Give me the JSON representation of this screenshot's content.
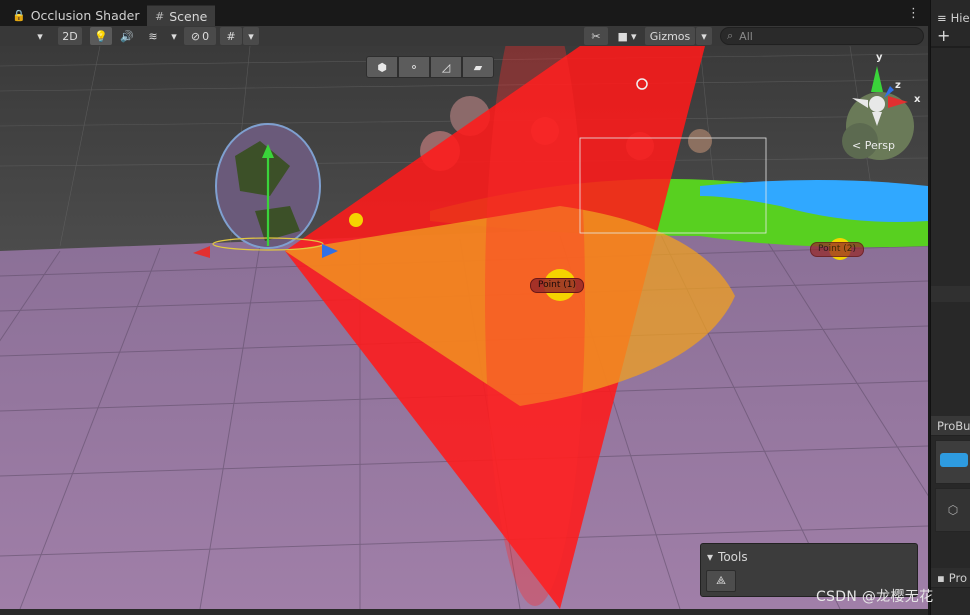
{
  "tabs": [
    {
      "label": "Occlusion Shader",
      "icon": "shader-icon",
      "active": false
    },
    {
      "label": "Scene",
      "icon": "grid-icon",
      "active": true
    }
  ],
  "toolbar": {
    "mode_2d": "2D",
    "hidden_count": "0",
    "gizmos_label": "Gizmos",
    "search_placeholder": "All"
  },
  "scene": {
    "projection_label": "Persp",
    "axis_x": "x",
    "axis_y": "y",
    "axis_z": "z",
    "point_label_1": "Point (1)",
    "point_label_2": "Point (2)"
  },
  "tools_overlay": {
    "title": "Tools"
  },
  "right_panel": {
    "hierarchy_tab": "Hie",
    "probuilder_tab": "ProBu",
    "project_tab": "Pro"
  },
  "watermark": "CSDN @龙樱无花",
  "colors": {
    "floor": "#9a7ba6",
    "cone_red": "#ff1a1a",
    "terrain_green": "#58d020",
    "water_blue": "#30a8ff",
    "point_light": "#f5d400"
  }
}
